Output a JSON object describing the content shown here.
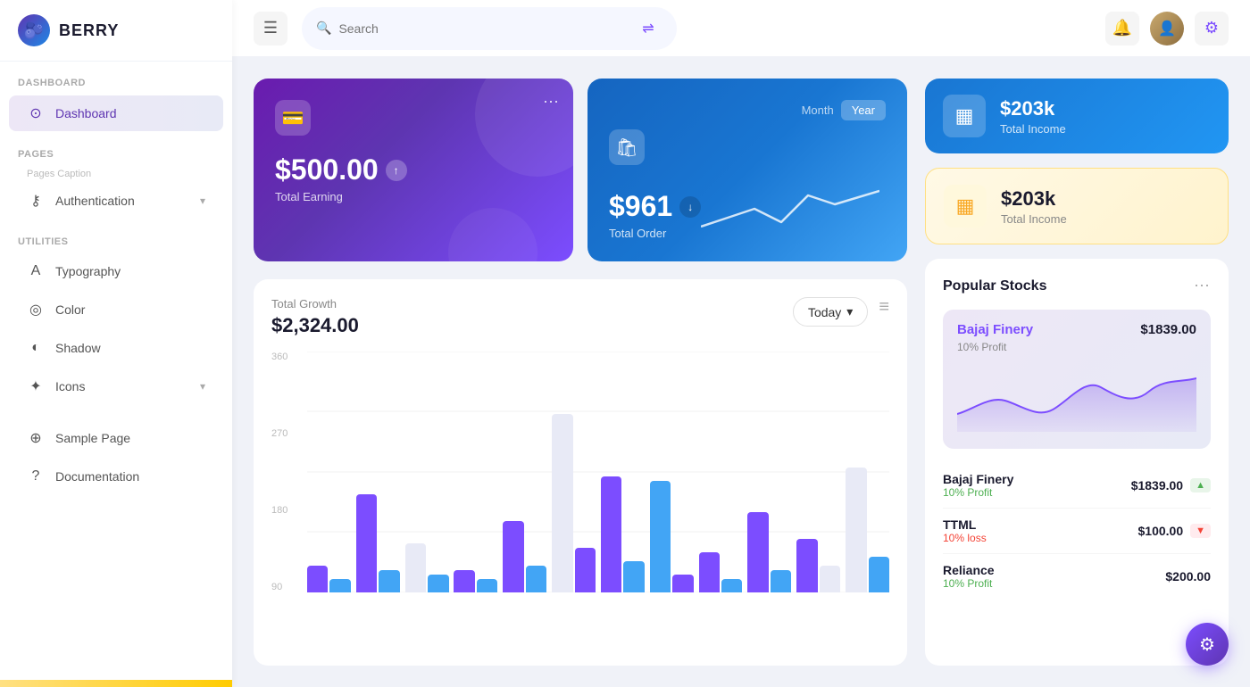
{
  "app": {
    "name": "BERRY"
  },
  "topbar": {
    "search_placeholder": "Search",
    "hamburger_label": "☰"
  },
  "sidebar": {
    "section_dashboard": "Dashboard",
    "dashboard_item": "Dashboard",
    "section_pages": "Pages",
    "pages_caption": "Pages Caption",
    "authentication_item": "Authentication",
    "section_utilities": "Utilities",
    "typography_item": "Typography",
    "color_item": "Color",
    "shadow_item": "Shadow",
    "icons_item": "Icons",
    "sample_page_item": "Sample Page",
    "documentation_item": "Documentation"
  },
  "earning_card": {
    "amount": "$500.00",
    "label": "Total Earning",
    "menu": "⋯"
  },
  "order_card": {
    "tab_month": "Month",
    "tab_year": "Year",
    "amount": "$961",
    "label": "Total Order"
  },
  "income_card_blue": {
    "amount": "$203k",
    "label": "Total Income"
  },
  "income_card_yellow": {
    "amount": "$203k",
    "label": "Total Income"
  },
  "growth_chart": {
    "title": "Total Growth",
    "amount": "$2,324.00",
    "today_btn": "Today",
    "y_labels": [
      "360",
      "270",
      "180",
      "90"
    ],
    "menu": "≡"
  },
  "stocks": {
    "title": "Popular Stocks",
    "menu": "⋯",
    "featured": {
      "name": "Bajaj Finery",
      "price": "$1839.00",
      "profit": "10% Profit"
    },
    "list": [
      {
        "name": "Bajaj Finery",
        "price": "$1839.00",
        "sub": "10% Profit",
        "trend": "up"
      },
      {
        "name": "TTML",
        "price": "$100.00",
        "sub": "10% loss",
        "trend": "down"
      },
      {
        "name": "Reliance",
        "price": "$200.00",
        "sub": "10% Profit",
        "trend": "up"
      }
    ]
  },
  "colors": {
    "purple": "#7c4dff",
    "blue": "#2196f3",
    "accent": "#5e35b1"
  }
}
